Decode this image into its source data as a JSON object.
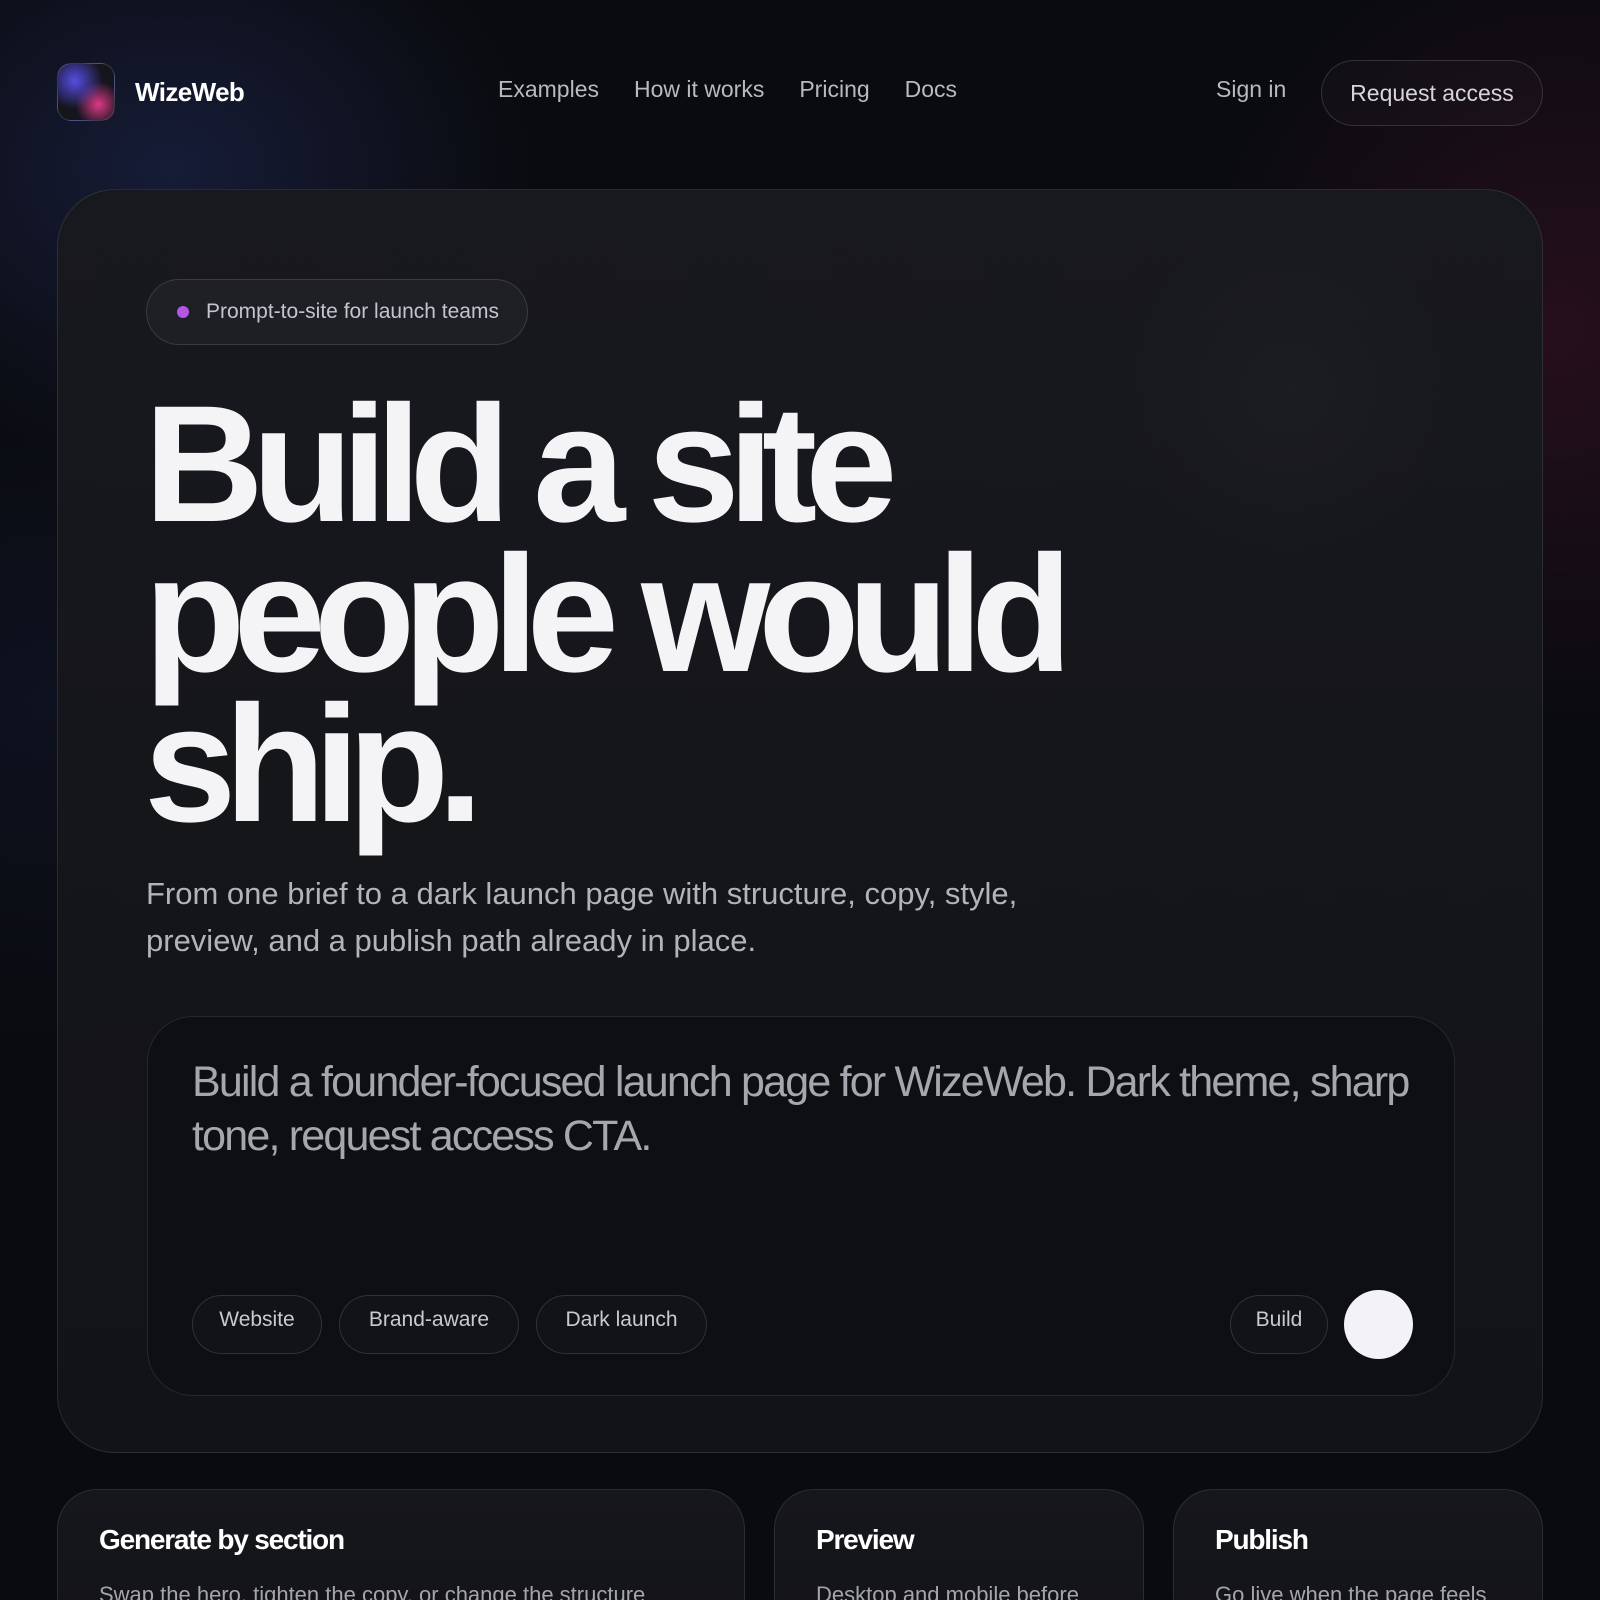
{
  "brand": {
    "name": "WizeWeb"
  },
  "nav": {
    "links": [
      "Examples",
      "How it works",
      "Pricing",
      "Docs"
    ],
    "sign_in": "Sign in",
    "cta": "Request access"
  },
  "hero": {
    "badge": "Prompt-to-site for launch teams",
    "headline": [
      "Build a site",
      "people would",
      "ship."
    ],
    "subhead": "From one brief to a dark launch page with structure, copy, style, preview, and a publish path already in place."
  },
  "prompt": {
    "text": "Build a founder-focused launch page for WizeWeb. Dark theme, sharp tone, request access CTA.",
    "chips": [
      "Website",
      "Brand-aware",
      "Dark launch"
    ],
    "build_label": "Build"
  },
  "features": [
    {
      "title": "Generate by section",
      "desc": "Swap the hero, tighten the copy, or change the structure"
    },
    {
      "title": "Preview",
      "desc": "Desktop and mobile before"
    },
    {
      "title": "Publish",
      "desc": "Go live when the page feels"
    }
  ],
  "colors": {
    "background": "#0a0b0f",
    "accent_dot": "#b456e6",
    "logo_blue": "#5a50f0",
    "logo_pink": "#e63c8c",
    "send_button": "#f3f2f7"
  }
}
